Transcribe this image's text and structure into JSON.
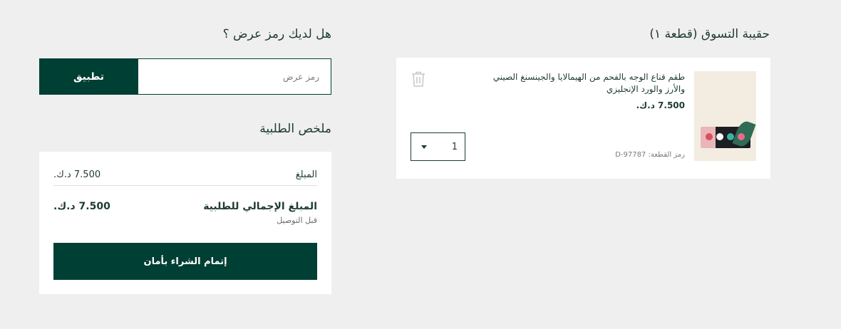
{
  "bag": {
    "title": "حقيبة التسوق (قطعة ١)",
    "item": {
      "name": "طقم قناع الوجه بالفحم من الهيمالايا والجينسنغ الصيني والأرز والورد الإنجليزي",
      "price": "7.500 د.ك.",
      "sku": "رمز القطعة: D-97787",
      "quantity": "1",
      "thumb_colors": [
        "#d94f5c",
        "#ffffff",
        "#3bb3a0",
        "#e86b8a"
      ]
    },
    "icons": {
      "delete": "trash-icon",
      "quantity": "chevron-down-icon"
    }
  },
  "promo": {
    "title": "هل لديك رمز عرض ؟",
    "placeholder": "رمز عرض",
    "apply_label": "تطبيق"
  },
  "summary": {
    "title": "ملخص الطلبية",
    "subtotal_label": "المبلغ",
    "subtotal_value": "7.500 د.ك.",
    "total_label": "المبلغ الإجمالي للطلبية",
    "total_value": "7.500 د.ك.",
    "total_note": "قبل التوصيل",
    "checkout_label": "إتمام الشراء بأمان"
  },
  "colors": {
    "brand": "#003f33",
    "text": "#1f3b34",
    "background": "#efefef"
  }
}
